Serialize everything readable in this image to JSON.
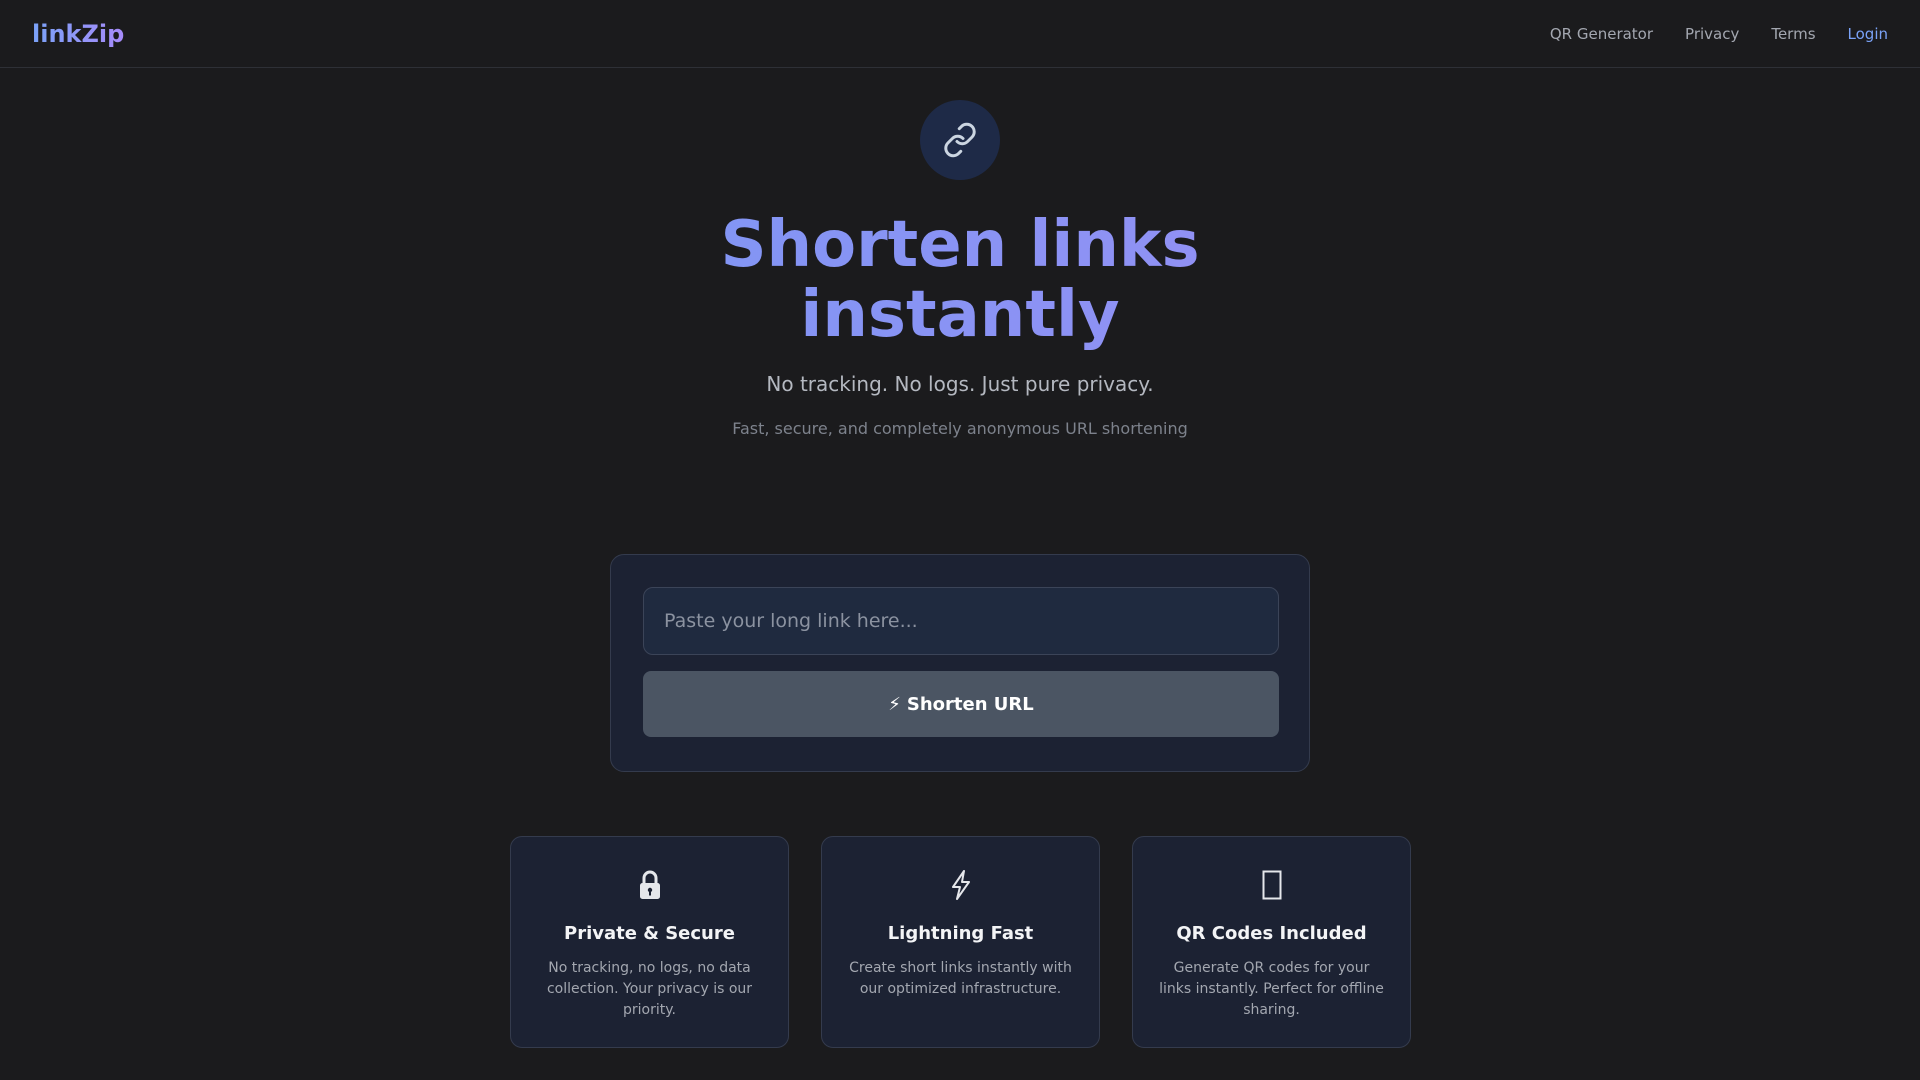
{
  "header": {
    "logo": "linkZip",
    "nav": [
      {
        "label": "QR Generator"
      },
      {
        "label": "Privacy"
      },
      {
        "label": "Terms"
      },
      {
        "label": "Login"
      }
    ]
  },
  "hero": {
    "icon": "link-icon",
    "title": "Shorten links instantly",
    "subtitle": "No tracking. No logs. Just pure privacy.",
    "tagline": "Fast, secure, and completely anonymous URL shortening"
  },
  "form": {
    "input_placeholder": "Paste your long link here...",
    "input_value": "",
    "button_icon": "⚡",
    "button_label": "Shorten URL"
  },
  "features": [
    {
      "icon": "lock-icon",
      "title": "Private & Secure",
      "text": "No tracking, no logs, no data collection. Your privacy is our priority."
    },
    {
      "icon": "lightning-icon",
      "title": "Lightning Fast",
      "text": "Create short links instantly with our optimized infrastructure."
    },
    {
      "icon": "qr-code-icon",
      "title": "QR Codes Included",
      "text": "Generate QR codes for your links instantly. Perfect for offline sharing."
    }
  ],
  "colors": {
    "background": "#1b1b1d",
    "accent": "#7aa2f7",
    "accent_secondary": "#a78bfa",
    "card": "#1c2233",
    "button": "#4b5563"
  }
}
